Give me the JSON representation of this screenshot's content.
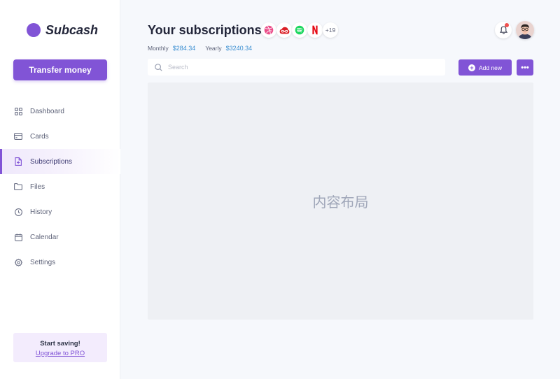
{
  "brand": {
    "name": "Subcash",
    "color": "#8154d6"
  },
  "sidebar": {
    "transfer_label": "Transfer money",
    "items": [
      {
        "label": "Dashboard",
        "icon": "grid-icon",
        "active": false
      },
      {
        "label": "Cards",
        "icon": "card-icon",
        "active": false
      },
      {
        "label": "Subscriptions",
        "icon": "document-icon",
        "active": true
      },
      {
        "label": "Files",
        "icon": "folder-icon",
        "active": false
      },
      {
        "label": "History",
        "icon": "clock-icon",
        "active": false
      },
      {
        "label": "Calendar",
        "icon": "calendar-icon",
        "active": false
      },
      {
        "label": "Settings",
        "icon": "gear-icon",
        "active": false
      }
    ],
    "promo": {
      "title": "Start saving!",
      "link": "Upgrade to PRO"
    }
  },
  "header": {
    "title": "Your subscriptions",
    "services": [
      "dribbble-icon",
      "creative-cloud-icon",
      "spotify-icon",
      "netflix-icon"
    ],
    "more_count": "+19",
    "stats": {
      "monthly_label": "Monthly",
      "monthly_value": "$284.34",
      "yearly_label": "Yearly",
      "yearly_value": "$3240.34"
    }
  },
  "toolbar": {
    "search_placeholder": "Search",
    "add_label": "Add new",
    "more_label": "•••"
  },
  "main": {
    "placeholder_text": "内容布局"
  },
  "colors": {
    "accent": "#8154d6",
    "value_blue": "#3a8ed1",
    "notification": "#f0504f"
  }
}
